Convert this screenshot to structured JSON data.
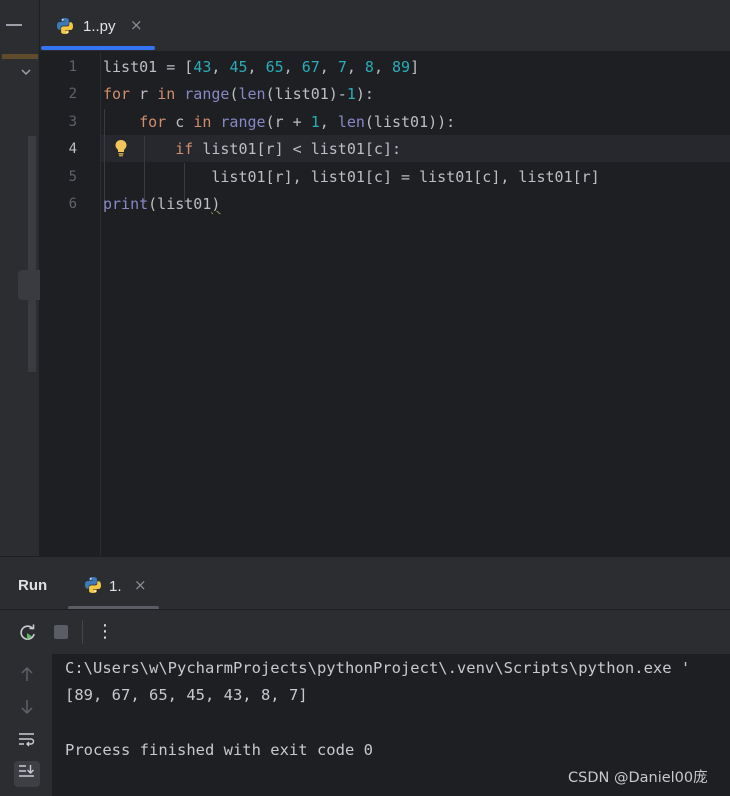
{
  "editor_tab": {
    "label": "1..py",
    "close_glyph": "×",
    "icon": "python-icon"
  },
  "editor": {
    "line_numbers": [
      "1",
      "2",
      "3",
      "4",
      "5",
      "6"
    ],
    "active_line": 4,
    "code": {
      "line1": {
        "t1": "list01 = [",
        "n1": "43",
        "s1": ", ",
        "n2": "45",
        "s2": ", ",
        "n3": "65",
        "s3": ", ",
        "n4": "67",
        "s4": ", ",
        "n5": "7",
        "s5": ", ",
        "n6": "8",
        "s6": ", ",
        "n7": "89",
        "t2": "]"
      },
      "line2": {
        "k1": "for",
        "t1": " r ",
        "k2": "in",
        "t2": " ",
        "b1": "range",
        "t3": "(",
        "b2": "len",
        "t4": "(list01)-",
        "n1": "1",
        "t5": "):"
      },
      "line3": {
        "indent": "    ",
        "k1": "for",
        "t1": " c ",
        "k2": "in",
        "t2": " ",
        "b1": "range",
        "t3": "(r + ",
        "n1": "1",
        "t4": ", ",
        "b2": "len",
        "t5": "(list01)):"
      },
      "line4": {
        "indent": "        ",
        "k1": "if",
        "t1": " list01[r] < list01[c]:"
      },
      "line5": {
        "indent": "            ",
        "t1": "list01[r], list01[c] = list01[c], list01[r]"
      },
      "line6": {
        "b1": "print",
        "t1": "(list01",
        "t2": ")"
      }
    }
  },
  "run_panel": {
    "title": "Run",
    "tab": {
      "label": "1.",
      "close_glyph": "×",
      "icon": "python-icon"
    },
    "toolbar": {
      "more_glyph": "⋮"
    },
    "console_lines": [
      "C:\\Users\\w\\PycharmProjects\\pythonProject\\.venv\\Scripts\\python.exe '",
      "[89, 67, 65, 45, 43, 8, 7]",
      "",
      "Process finished with exit code 0"
    ],
    "side_icons": [
      "up-arrow-icon",
      "down-arrow-icon",
      "soft-wrap-icon",
      "scroll-to-end-icon"
    ]
  },
  "watermark": "CSDN @Daniel00庞",
  "colors": {
    "keyword": "#cf8e6d",
    "number": "#2aacb8",
    "builtin": "#8888c6",
    "accent": "#3574f0"
  }
}
